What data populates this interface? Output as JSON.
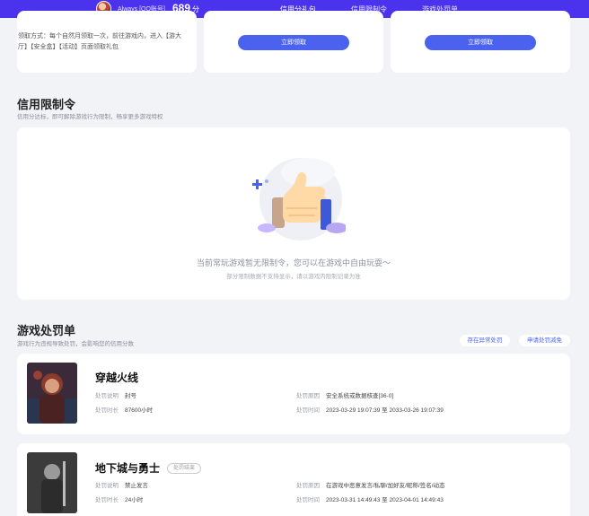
{
  "header": {
    "username": "Always [QQ账号]",
    "score": "689",
    "score_unit": "分",
    "tabs": [
      {
        "label": "信用分礼包"
      },
      {
        "label": "信用限制令"
      },
      {
        "label": "游戏处罚单"
      }
    ]
  },
  "gifts": {
    "claim_text": "领取方式：每个自然月领取一次，前往游戏内，进入【游大厅】【安全盒】【活动】页面领取礼包",
    "buttons": [
      {
        "label": "立即领取"
      },
      {
        "label": "立即领取"
      }
    ]
  },
  "restriction": {
    "title": "信用限制令",
    "subtitle": "信用分达标，即可解除游戏行为限制，畅享更多游戏特权",
    "empty_main": "当前常玩游戏暂无限制令，您可以在游戏中自由玩耍～",
    "empty_sub": "部分限制数据不支持显示，请以游戏内限制记录为准"
  },
  "penalty": {
    "title": "游戏处罚单",
    "subtitle": "游戏行为违规导致处罚，会影响您的信用分数",
    "actions": [
      {
        "label": "存在异常处罚"
      },
      {
        "label": "申请处罚减免"
      }
    ],
    "labels": {
      "desc": "处罚说明",
      "duration": "处罚时长",
      "reason": "处罚原因",
      "time": "处罚时间"
    },
    "records": [
      {
        "game": "穿越火线",
        "status": "",
        "desc": "封号",
        "duration": "87600小时",
        "reason": "安全系统或数据核查[36-0]",
        "time": "2023-03-29 19:07:39 至 2033-03-26 19:07:39"
      },
      {
        "game": "地下城与勇士",
        "status": "处罚结束",
        "desc": "禁止发言",
        "duration": "24小时",
        "reason": "在游戏中恶意发言/私聊/加好友/昵称/签名/动态",
        "time": "2023-03-31 14:49:43 至 2023-04-01 14:49:43"
      }
    ]
  }
}
